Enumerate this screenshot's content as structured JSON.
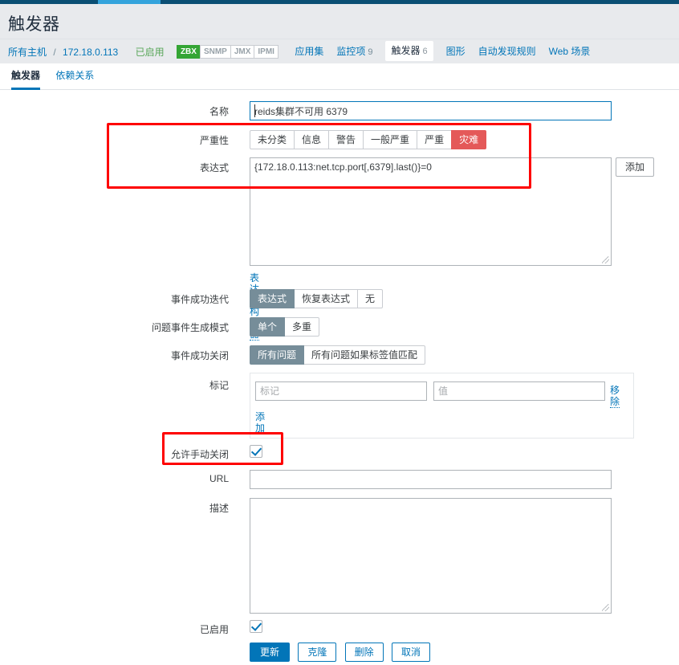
{
  "page": {
    "title": "触发器"
  },
  "breadcrumb": {
    "all_hosts": "所有主机",
    "separator": "/",
    "host": "172.18.0.113",
    "status": "已启用",
    "protocols": [
      {
        "label": "ZBX",
        "active": true
      },
      {
        "label": "SNMP",
        "active": false
      },
      {
        "label": "JMX",
        "active": false
      },
      {
        "label": "IPMI",
        "active": false
      }
    ],
    "nav_items": [
      {
        "label": "应用集",
        "count": "",
        "selected": false
      },
      {
        "label": "监控项",
        "count": "9",
        "selected": false
      },
      {
        "label": "触发器",
        "count": "6",
        "selected": true
      },
      {
        "label": "图形",
        "count": "",
        "selected": false
      },
      {
        "label": "自动发现规则",
        "count": "",
        "selected": false
      },
      {
        "label": "Web 场景",
        "count": "",
        "selected": false
      }
    ]
  },
  "tabs": [
    {
      "label": "触发器",
      "active": true
    },
    {
      "label": "依赖关系",
      "active": false
    }
  ],
  "form": {
    "name": {
      "label": "名称",
      "value": "reids集群不可用 6379",
      "placeholder": ""
    },
    "severity": {
      "label": "严重性",
      "options": [
        {
          "label": "未分类",
          "selected": false
        },
        {
          "label": "信息",
          "selected": false
        },
        {
          "label": "警告",
          "selected": false
        },
        {
          "label": "一般严重",
          "selected": false
        },
        {
          "label": "严重",
          "selected": false
        },
        {
          "label": "灾难",
          "selected": true
        }
      ],
      "selected_color": "#e45959"
    },
    "expression": {
      "label": "表达式",
      "value": "{172.18.0.113:net.tcp.port[,6379].last()}=0",
      "add_button": "添加",
      "constructor_link": "表达式构造器"
    },
    "ok_event_generation": {
      "label": "事件成功迭代",
      "options": [
        {
          "label": "表达式",
          "selected": true
        },
        {
          "label": "恢复表达式",
          "selected": false
        },
        {
          "label": "无",
          "selected": false
        }
      ]
    },
    "problem_event_mode": {
      "label": "问题事件生成模式",
      "options": [
        {
          "label": "单个",
          "selected": true
        },
        {
          "label": "多重",
          "selected": false
        }
      ]
    },
    "ok_event_closes": {
      "label": "事件成功关闭",
      "options": [
        {
          "label": "所有问题",
          "selected": true
        },
        {
          "label": "所有问题如果标签值匹配",
          "selected": false
        }
      ]
    },
    "tags": {
      "label": "标记",
      "rows": [
        {
          "tag_value": "",
          "tag_placeholder": "标记",
          "value_value": "",
          "value_placeholder": "值",
          "remove_label": "移除"
        }
      ],
      "add_label": "添加"
    },
    "allow_manual_close": {
      "label": "允许手动关闭",
      "checked": true
    },
    "url": {
      "label": "URL",
      "value": "",
      "placeholder": ""
    },
    "description": {
      "label": "描述",
      "value": "",
      "placeholder": ""
    },
    "enabled": {
      "label": "已启用",
      "checked": true
    },
    "actions": [
      {
        "label": "更新",
        "style": "primary"
      },
      {
        "label": "克隆",
        "style": "secondary"
      },
      {
        "label": "删除",
        "style": "secondary"
      },
      {
        "label": "取消",
        "style": "secondary"
      }
    ]
  },
  "annotations": {
    "accent_color": "#fe0000",
    "boxes": [
      {
        "name": "severity-expression-highlight"
      },
      {
        "name": "allow-manual-close-highlight"
      }
    ]
  },
  "colors": {
    "topbar": "#0b4f74",
    "topbar_active": "#33a3dc",
    "link": "#0275b8",
    "status_enabled": "#59a659",
    "proto_on": "#34a534",
    "segment_selected": "#768d99",
    "disaster": "#e45959"
  }
}
